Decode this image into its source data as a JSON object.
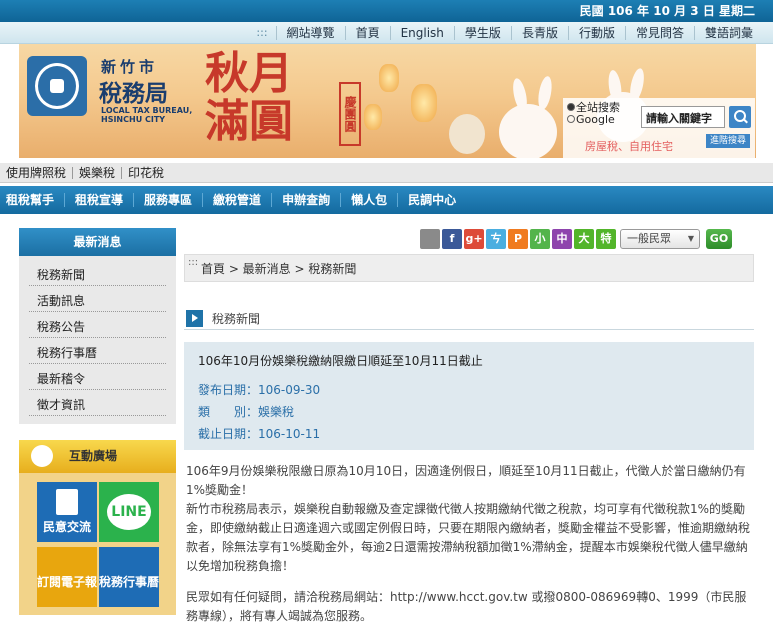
{
  "date_bar": "民國 106 年 10 月 3 日 星期二",
  "top_nav": {
    "dots": ":::",
    "items": [
      "網站導覽",
      "首頁",
      "English",
      "學生版",
      "長青版",
      "行動版",
      "常見問答",
      "雙語詞彙"
    ]
  },
  "banner": {
    "logo_city": "新竹市",
    "logo_name": "稅務局",
    "logo_en": "LOCAL TAX BUREAU, HSINCHU CITY",
    "festival_text": "秋月滿圓",
    "stamp_text": "慶團圓"
  },
  "search": {
    "option_all": "全站搜索",
    "option_google": "Google",
    "input_value": "請輸入關鍵字",
    "links": "房屋稅、自用住宅",
    "advanced_label": "進階搜尋"
  },
  "quick_nav": [
    "使用牌照稅",
    "娛樂稅",
    "印花稅"
  ],
  "main_nav": [
    "租稅幫手",
    "租稅宣導",
    "服務專區",
    "繳稅管道",
    "申辦查詢",
    "懶人包",
    "民調中心"
  ],
  "sidebar": {
    "title": "最新消息",
    "items": [
      "稅務新聞",
      "活動訊息",
      "稅務公告",
      "稅務行事曆",
      "最新稽令",
      "徵才資訊"
    ]
  },
  "interactive": {
    "title": "互動廣場",
    "tiles": [
      "民意交流",
      "LINE",
      "訂閱電子報",
      "稅務行事曆"
    ]
  },
  "toolbar": {
    "icons": [
      "print-icon",
      "facebook-icon",
      "googleplus-icon",
      "plurk-icon",
      "punchline-icon",
      "small-font-icon",
      "medium-font-icon",
      "large-font-icon",
      "xl-font-icon"
    ],
    "glyphs": [
      "",
      "f",
      "g+",
      "ㄘ",
      "P",
      "小",
      "中",
      "大",
      "特"
    ],
    "colors": [
      "#8a8a8a",
      "#3b5998",
      "#dd4b39",
      "#4aaee0",
      "#f07b20",
      "#53b44b",
      "#8e44ad",
      "#52b52a",
      "#52b52a"
    ],
    "audience_select": "一般民眾",
    "go_label": "GO"
  },
  "breadcrumb": {
    "dots": ":::",
    "text": "首頁 > 最新消息 > 稅務新聞"
  },
  "section_title": "稅務新聞",
  "article": {
    "title": "106年10月份娛樂稅繳納限繳日順延至10月11日截止",
    "publish": "發布日期：106-09-30",
    "category": "類　　別：娛樂稅",
    "deadline": "截止日期：106-10-11",
    "paragraph1": "106年9月份娛樂稅限繳日原為10月10日，因適逢例假日，順延至10月11日截止，代徵人於當日繳納仍有1%獎勵金！",
    "paragraph2": "新竹市稅務局表示，娛樂稅自動報繳及查定課徵代徵人按期繳納代徵之稅款，均可享有代徵稅款1%的獎勵金，即使繳納截止日適逢週六或國定例假日時，只要在期限內繳納者，獎勵金權益不受影響，惟逾期繳納稅款者，除無法享有1%獎勵金外，每逾2日還需按滯納稅額加徵1%滯納金，提醒本市娛樂稅代徵人儘早繳納以免增加稅務負擔！",
    "paragraph3": "民眾如有任何疑問，請洽稅務局網站：http://www.hcct.gov.tw 或撥0800-086969轉0、1999（市民服務專線），將有專人竭誠為您服務。"
  }
}
